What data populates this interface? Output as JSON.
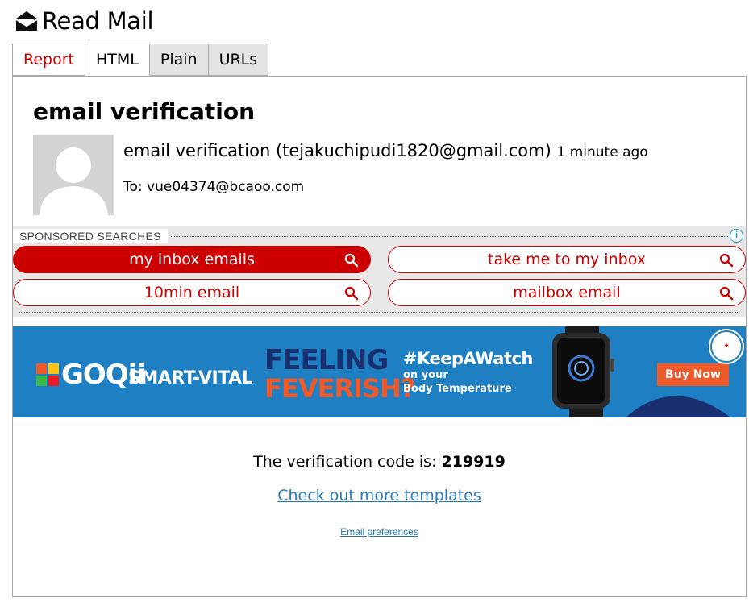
{
  "app": {
    "title": "Read Mail",
    "icon": "envelope-open-icon"
  },
  "tabs": [
    {
      "label": "Report"
    },
    {
      "label": "HTML"
    },
    {
      "label": "Plain"
    },
    {
      "label": "URLs"
    }
  ],
  "message": {
    "subject": "email verification",
    "from": "email verification (tejakuchipudi1820@gmail.com)",
    "time": "1 minute ago",
    "to": "To: vue04374@bcaoo.com"
  },
  "sponsored": {
    "label": "SPONSORED SEARCHES",
    "info_icon": "info-icon",
    "searches": [
      {
        "label": "my inbox emails"
      },
      {
        "label": "take me to my inbox"
      },
      {
        "label": "10min email"
      },
      {
        "label": "mailbox email"
      }
    ]
  },
  "banner": {
    "brand": "GOQii",
    "brand_sub": "SMART-VITAL",
    "headline1": "FEELING",
    "headline2": "FEVERISH?",
    "tagline": "#KeepAWatch",
    "tagline_sub1": "on your",
    "tagline_sub2": "Body Temperature",
    "cta": "Buy Now",
    "colors": {
      "background": "#1e7fc3",
      "cta": "#f05a28",
      "headline": "#1a2f6f"
    }
  },
  "email_body": {
    "code_label": "The verification code is: ",
    "code": "219919",
    "templates_link": "Check out more templates",
    "preferences_link": "Email preferences"
  },
  "colors": {
    "accent": "#cc0000",
    "link": "#2a7ab8"
  }
}
